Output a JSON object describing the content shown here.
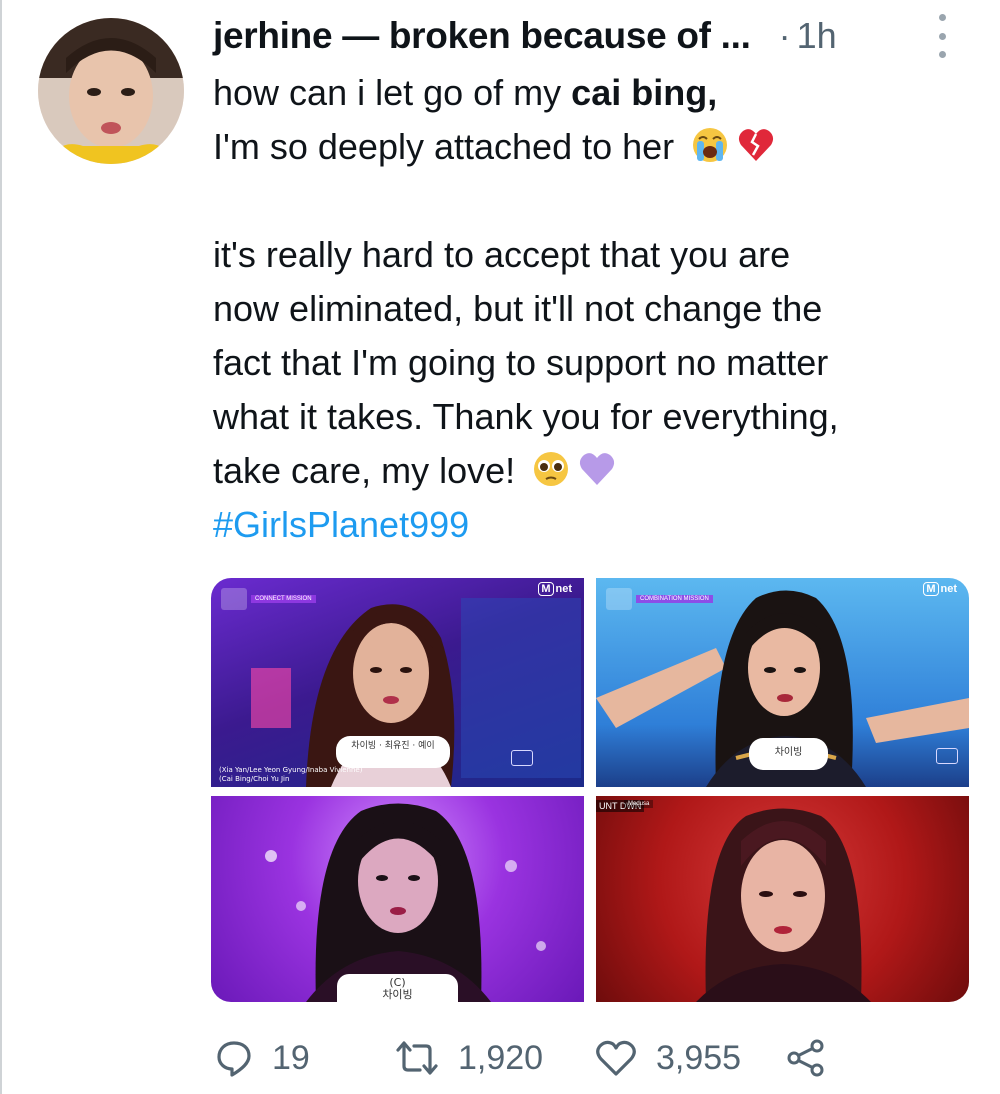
{
  "tweet": {
    "display_name": "jerhine — broken because of ...",
    "time_separator": "·",
    "time": "1h",
    "text_lines": [
      "how can i let go of my ",
      "I'm so deeply attached to her",
      "it's really hard to accept that you are",
      "now eliminated, but it'll not change the",
      "fact that I'm going to support no matter",
      "what it takes. Thank you for everything,",
      "take care, my love!"
    ],
    "bold_name": "cai bing",
    "bold_suffix": ",",
    "hashtag": "#GirlsPlanet999",
    "emojis": [
      "loudly-crying-face",
      "broken-heart",
      "pleading-face",
      "purple-heart"
    ]
  },
  "media": {
    "tile1": {
      "mnet": "net",
      "mission": "CONNECT MISSION",
      "caption_top": "차이빙 · 최유진 · 예이",
      "credit_line1": "(Xia Yan/Lee Yeon Gyung/Inaba Vivienne)",
      "credit_line2": "(Cai Bing/Choi Yu Jin"
    },
    "tile2": {
      "mnet": "net",
      "mission": "COMBINATION MISSION",
      "caption": "차이빙"
    },
    "tile3": {
      "caption_line1": "(C)",
      "caption_line2": "차이빙"
    },
    "tile4": {
      "show": "UNT DWN",
      "song": "Medusa"
    }
  },
  "actions": {
    "replies": "19",
    "retweets": "1,920",
    "likes": "3,955"
  },
  "colors": {
    "link": "#1d9bf0",
    "meta": "#536471",
    "text": "#0f1419"
  }
}
